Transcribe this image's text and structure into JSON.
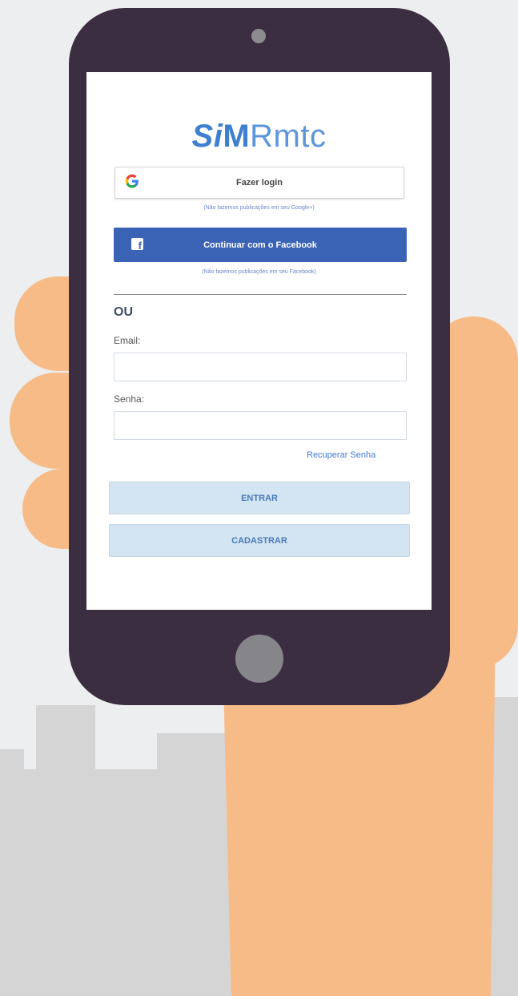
{
  "app": {
    "logo_si": "Si",
    "logo_m": "M",
    "logo_rmtc": "Rmtc"
  },
  "google": {
    "button_label": "Fazer login",
    "note": "(Não fazemos publicações em seu Google+)"
  },
  "facebook": {
    "button_label": "Continuar com o Facebook",
    "note": "(Não fazemos publicações em seu Facebook)"
  },
  "divider_text": "OU",
  "form": {
    "email_label": "Email:",
    "email_value": "",
    "password_label": "Senha:",
    "password_value": "",
    "recover_link": "Recuperar Senha"
  },
  "actions": {
    "enter_label": "ENTRAR",
    "register_label": "CADASTRAR"
  },
  "colors": {
    "brand": "#3f7fd0",
    "facebook": "#3b63b5",
    "light_button": "#d3e5f2",
    "phone_body": "#3b2e40",
    "hand": "#f7bb88",
    "skyline": "#d5d5d5"
  },
  "icons": [
    "google-icon",
    "facebook-icon"
  ]
}
